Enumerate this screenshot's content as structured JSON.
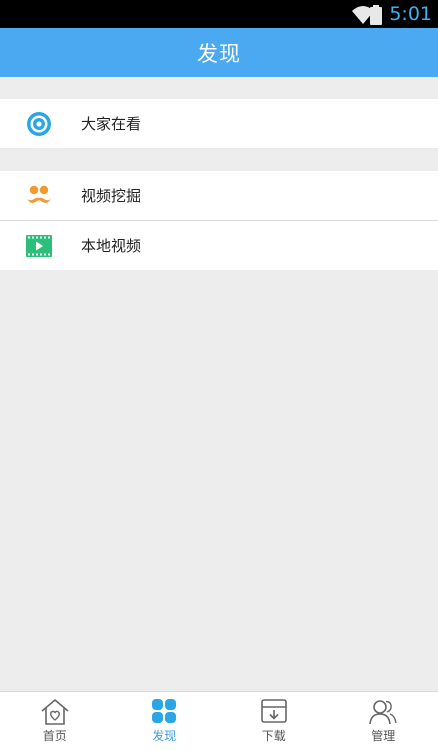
{
  "status_bar": {
    "time": "5:01",
    "time_color": "#3fb0f0",
    "wifi_icon": "wifi-icon",
    "battery_icon": "battery-icon"
  },
  "header": {
    "title": "发现",
    "background_color": "#4aa9f0"
  },
  "groups": [
    {
      "items": [
        {
          "label": "大家在看",
          "icon": "eye-icon",
          "icon_color": "#2aa6e6"
        }
      ]
    },
    {
      "items": [
        {
          "label": "视频挖掘",
          "icon": "mustache-icon",
          "icon_color": "#f29a2e"
        },
        {
          "label": "本地视频",
          "icon": "film-play-icon",
          "icon_color": "#2bc07a"
        }
      ]
    }
  ],
  "tabs": [
    {
      "label": "首页",
      "icon": "home-icon",
      "active": false
    },
    {
      "label": "发现",
      "icon": "discover-grid-icon",
      "active": true
    },
    {
      "label": "下载",
      "icon": "download-icon",
      "active": false
    },
    {
      "label": "管理",
      "icon": "users-icon",
      "active": false
    }
  ],
  "colors": {
    "accent": "#3a9de6",
    "background": "#ededed"
  }
}
